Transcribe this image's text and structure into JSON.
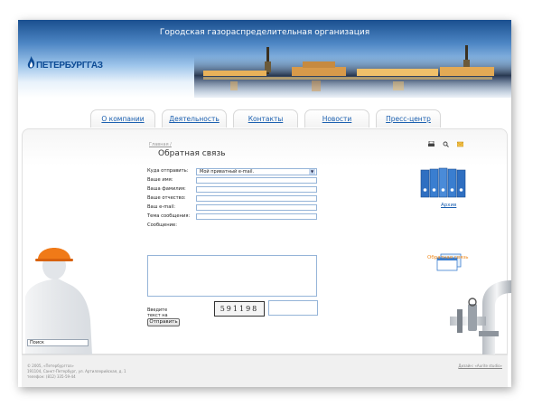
{
  "header": {
    "org_title": "Городская газораспределительная организация",
    "logo_text": "ПЕТЕРБУРГГАЗ"
  },
  "nav": {
    "tabs": [
      "О компании",
      "Деятельность",
      "Контакты",
      "Новости",
      "Пресс-центр"
    ]
  },
  "page": {
    "breadcrumb": "Главная /",
    "title": "Обратная связь"
  },
  "tools": {
    "icons": [
      "print-icon",
      "search-icon",
      "mail-icon"
    ]
  },
  "form": {
    "send_to_label": "Куда отправить:",
    "send_to_value": "Мой приватный e-mail.",
    "first_name_label": "Ваше имя:",
    "last_name_label": "Ваша фамилия:",
    "patronymic_label": "Ваше отчество:",
    "email_label": "Ваш e-mail:",
    "subject_label": "Тема сообщения:",
    "message_label": "Сообщение:",
    "captcha_label": "Введите текст на картинке:",
    "captcha_text": "591198",
    "submit_label": "Отправить"
  },
  "sidebar": {
    "archive_label": "Архив",
    "feedback_label": "Обратная связь"
  },
  "search": {
    "value": "Поиск"
  },
  "footer": {
    "copyright": "© 2005, «Петербурггаз»",
    "address": "191104, Санкт-Петербург, ул. Артиллерийская, д. 1",
    "phone": "телефон: (812) 335-59-44",
    "credit": "Дизайн: «Aurite studio»"
  },
  "colors": {
    "brand_blue": "#0d4b95",
    "link_blue": "#1a5fb0",
    "accent_orange": "#f08a1c"
  }
}
